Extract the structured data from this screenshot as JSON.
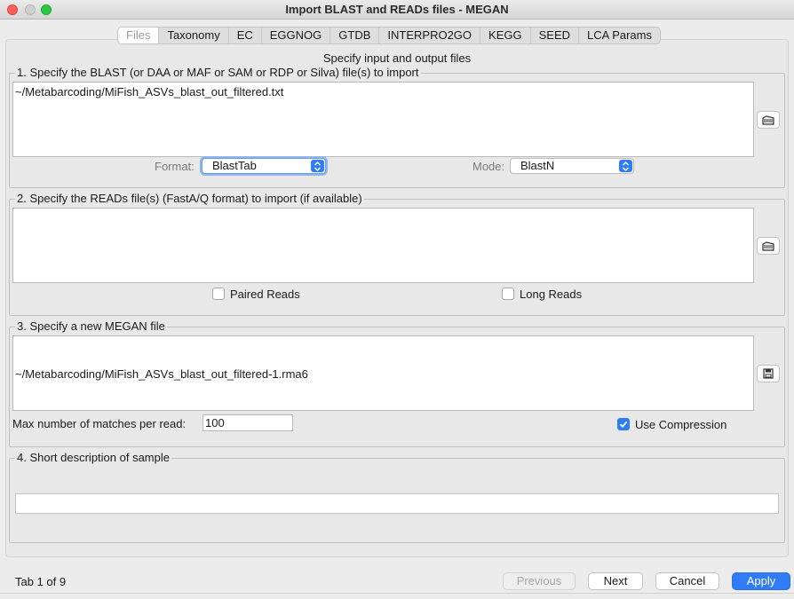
{
  "window": {
    "title": "Import BLAST and READs files - MEGAN"
  },
  "tabs": [
    {
      "label": "Files",
      "active": true
    },
    {
      "label": "Taxonomy"
    },
    {
      "label": "EC"
    },
    {
      "label": "EGGNOG"
    },
    {
      "label": "GTDB"
    },
    {
      "label": "INTERPRO2GO"
    },
    {
      "label": "KEGG"
    },
    {
      "label": "SEED"
    },
    {
      "label": "LCA Params"
    }
  ],
  "heading": "Specify input and output files",
  "section1": {
    "legend": "1. Specify the BLAST (or DAA or MAF or SAM or RDP or Silva) file(s) to import",
    "file_path": "~/Metabarcoding/MiFish_ASVs_blast_out_filtered.txt",
    "format_label": "Format:",
    "format_value": "BlastTab",
    "mode_label": "Mode:",
    "mode_value": "BlastN"
  },
  "section2": {
    "legend": "2. Specify the READs file(s) (FastA/Q format) to import (if available)",
    "file_path": "",
    "paired_label": "Paired Reads",
    "paired_checked": false,
    "long_label": "Long Reads",
    "long_checked": false
  },
  "section3": {
    "legend": "3. Specify a new MEGAN file",
    "file_path": "~/Metabarcoding/MiFish_ASVs_blast_out_filtered-1.rma6",
    "max_matches_label": "Max number of matches per read:",
    "max_matches_value": "100",
    "compression_label": "Use Compression",
    "compression_checked": true
  },
  "section4": {
    "legend": "4. Short description of sample",
    "description": ""
  },
  "footer": {
    "tab_status": "Tab 1 of 9",
    "previous_label": "Previous",
    "next_label": "Next",
    "cancel_label": "Cancel",
    "apply_label": "Apply"
  },
  "colors": {
    "accent": "#2f7cf6",
    "close": "#fe5f57",
    "maximize": "#2ac840"
  },
  "icons": [
    "open-folder-icon",
    "save-disk-icon",
    "stepper-icon",
    "checkmark-icon"
  ]
}
